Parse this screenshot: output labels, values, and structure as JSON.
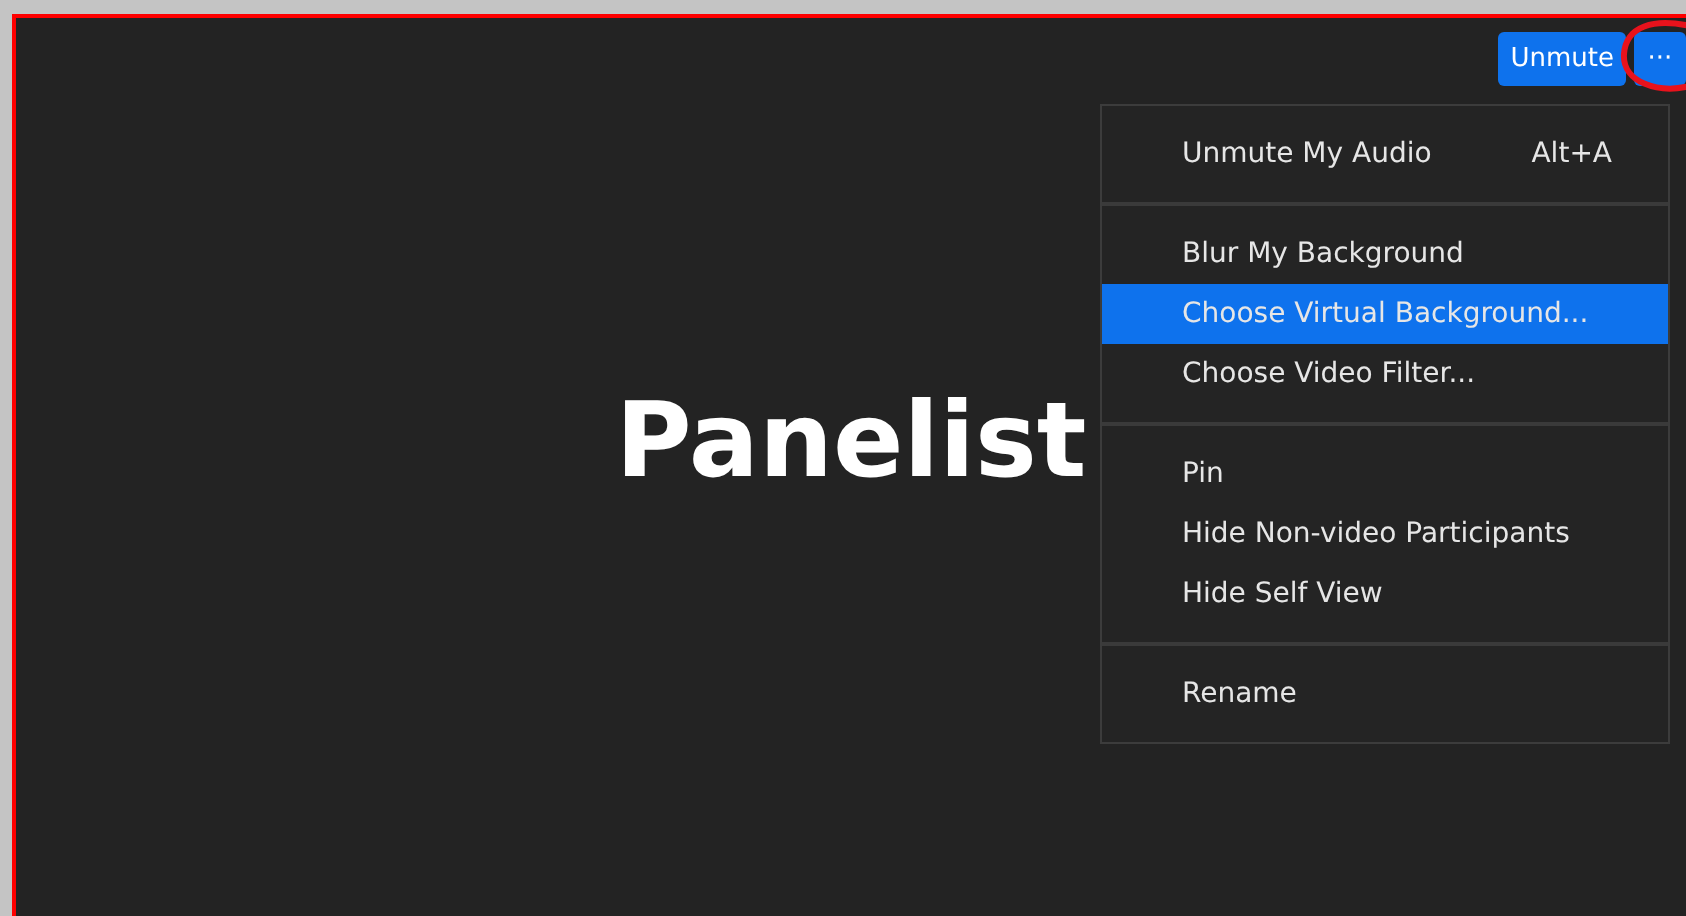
{
  "video_tile": {
    "name": "Panelist"
  },
  "toolbar": {
    "unmute_button": "Unmute",
    "more_button": "···"
  },
  "menu": {
    "groups": [
      {
        "items": [
          {
            "label": "Unmute My Audio",
            "shortcut": "Alt+A",
            "selected": false
          }
        ]
      },
      {
        "items": [
          {
            "label": "Blur My Background",
            "selected": false
          },
          {
            "label": "Choose Virtual Background...",
            "selected": true
          },
          {
            "label": "Choose Video Filter...",
            "selected": false
          }
        ]
      },
      {
        "items": [
          {
            "label": "Pin",
            "selected": false
          },
          {
            "label": "Hide Non-video Participants",
            "selected": false
          },
          {
            "label": "Hide Self View",
            "selected": false
          }
        ]
      },
      {
        "items": [
          {
            "label": "Rename",
            "selected": false
          }
        ]
      }
    ]
  }
}
